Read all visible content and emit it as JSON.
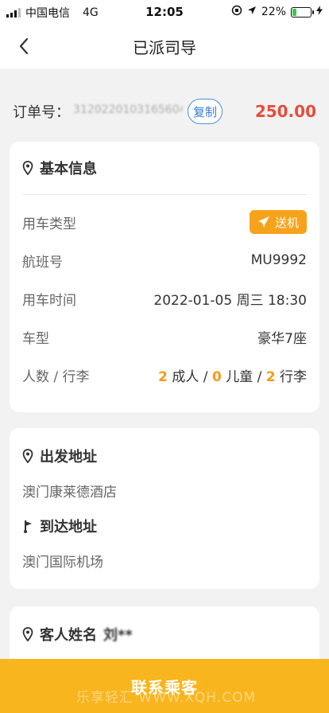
{
  "status_bar": {
    "carrier": "中国电信",
    "network": "4G",
    "time": "12:05",
    "battery_percent": "22%",
    "battery_level": 0.22
  },
  "nav": {
    "title": "已派司导"
  },
  "order": {
    "label": "订单号：",
    "number": "3120220103165604",
    "copy_label": "复制",
    "price": "250.00"
  },
  "basic_info": {
    "title": "基本信息",
    "rows": [
      {
        "label": "用车类型",
        "tag": "送机"
      },
      {
        "label": "航班号",
        "value": "MU9992"
      },
      {
        "label": "用车时间",
        "value": "2022-01-05 周三 18:30"
      },
      {
        "label": "车型",
        "value": "豪华7座"
      },
      {
        "label": "人数 / 行李"
      }
    ],
    "counts": {
      "adults": "2",
      "adults_label": "成人",
      "children": "0",
      "children_label": "儿童",
      "luggage": "2",
      "luggage_label": "行李",
      "sep": " / "
    }
  },
  "address": {
    "departure_title": "出发地址",
    "departure": "澳门康莱德酒店",
    "arrival_title": "到达地址",
    "arrival": "澳门国际机场"
  },
  "guest": {
    "title": "客人姓名",
    "name": "刘**"
  },
  "footer": {
    "contact_label": "联系乘客",
    "watermark": "乐享轻汇 WWW.XQH.COM"
  },
  "colors": {
    "accent": "#f8b51d",
    "price": "#e74c3c",
    "tag": "#f7a21b",
    "link": "#3b7dd8"
  },
  "icons": {
    "back": "chevron-left-icon",
    "location": "location-pin-icon",
    "plane": "airplane-icon",
    "flag": "flag-icon"
  }
}
